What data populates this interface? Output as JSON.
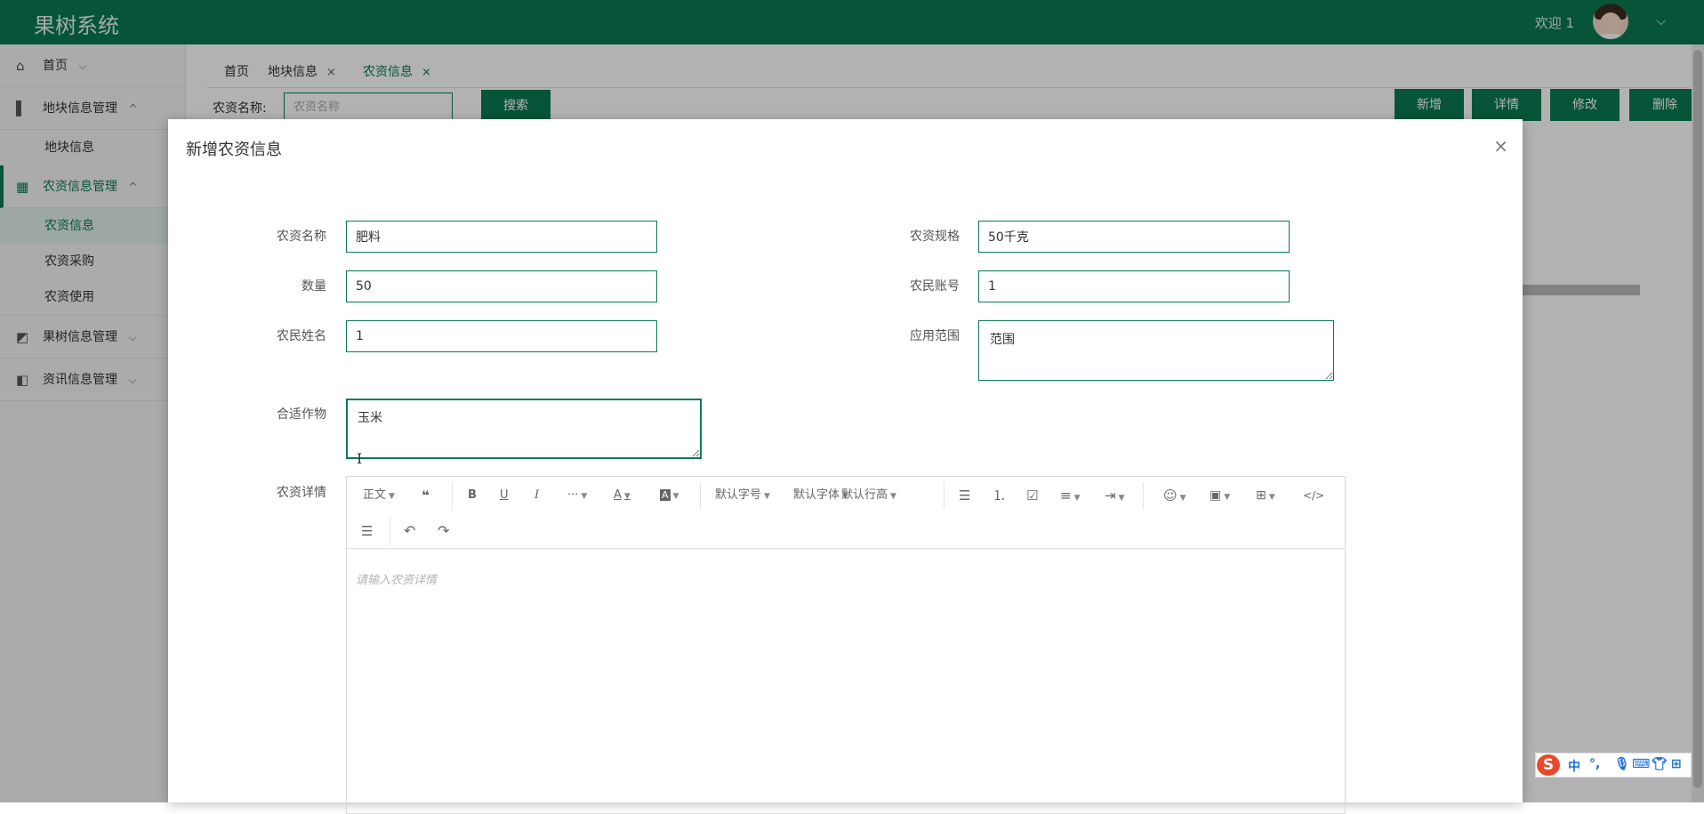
{
  "header": {
    "brand": "果树系统",
    "welcome": "欢迎 1",
    "user_caret": "⌵"
  },
  "sidebar": {
    "items": [
      {
        "label": "首页",
        "icon": "home-icon",
        "caret": "⌵"
      },
      {
        "label": "地块信息管理",
        "icon": "panel-icon",
        "caret": "^"
      },
      {
        "label": "地块信息",
        "sub": true
      },
      {
        "label": "农资信息管理",
        "icon": "dashboard-icon",
        "caret": "^",
        "active": true
      },
      {
        "label": "农资信息",
        "sub": true,
        "active": true
      },
      {
        "label": "农资采购",
        "sub": true
      },
      {
        "label": "农资使用",
        "sub": true
      },
      {
        "label": "果树信息管理",
        "icon": "chart-icon",
        "caret": "⌵"
      },
      {
        "label": "资讯信息管理",
        "icon": "layout-icon",
        "caret": "⌵"
      }
    ]
  },
  "tabs": [
    {
      "label": "首页"
    },
    {
      "label": "地块信息",
      "close": "×"
    },
    {
      "label": "农资信息",
      "close": "×",
      "active": true
    }
  ],
  "search": {
    "label": "农资名称:",
    "placeholder": "农资名称",
    "button": "搜索"
  },
  "actions": {
    "add": "新增",
    "detail": "详情",
    "edit": "修改",
    "delete": "删除"
  },
  "modal": {
    "title": "新增农资信息",
    "close": "×",
    "fields": {
      "name": {
        "label": "农资名称",
        "value": "肥料"
      },
      "spec": {
        "label": "农资规格",
        "value": "50千克"
      },
      "quantity": {
        "label": "数量",
        "value": "50"
      },
      "farmer_account": {
        "label": "农民账号",
        "value": "1"
      },
      "farmer_name": {
        "label": "农民姓名",
        "value": "1"
      },
      "scope": {
        "label": "应用范围",
        "value": "范围"
      },
      "crops": {
        "label": "合适作物",
        "value": "玉米"
      },
      "detail": {
        "label": "农资详情",
        "placeholder": "请输入农资详情"
      }
    },
    "editor_toolbar": {
      "paragraph": "正文",
      "font_size": "默认字号",
      "font_family": "默认字体",
      "line_height": "默认行高",
      "text_color": "A",
      "bg_color": "A",
      "more": "···",
      "bold": "B",
      "underline": "U",
      "italic": "I"
    }
  },
  "ime": {
    "lang": "中",
    "punct": "°,"
  },
  "colors": {
    "primary": "#0a7a52",
    "overlay": "rgba(0,0,0,0.30)"
  }
}
